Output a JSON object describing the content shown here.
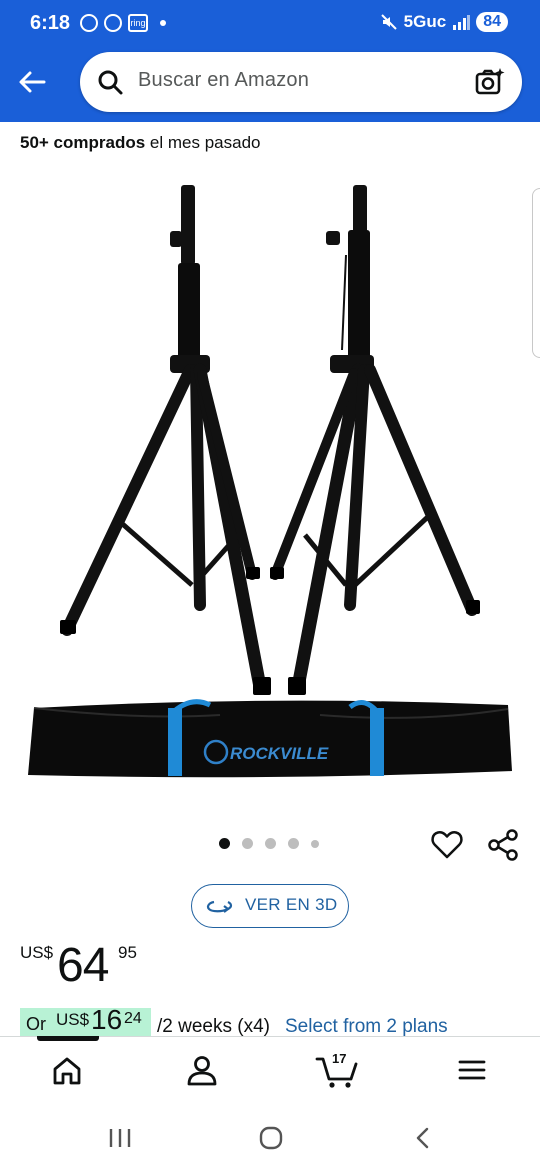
{
  "status_bar": {
    "time": "6:18",
    "app_badge": "ring",
    "network": "5Guc",
    "battery": "84"
  },
  "search": {
    "placeholder": "Buscar en Amazon"
  },
  "product": {
    "purchased_bold": "50+ comprados",
    "purchased_rest": " el mes pasado",
    "image_brand": "ROCKVILLE",
    "image_count": 5,
    "image_active_index": 0,
    "view_3d_label": "VER EN 3D"
  },
  "price": {
    "currency": "US$",
    "whole": "64",
    "fraction": "95"
  },
  "installment": {
    "prefix": "Or",
    "currency": "US$",
    "whole": "16",
    "fraction": "24",
    "period_text": "/2 weeks (x4)",
    "link": "Select from 2 plans"
  },
  "bottom_nav": {
    "items": [
      "home-icon",
      "account-icon",
      "cart-icon",
      "menu-icon"
    ],
    "cart_count": "17",
    "active": "home"
  },
  "colors": {
    "header_bg": "#1a5fd8",
    "link": "#2162a1",
    "installment_badge": "#b8f2d5"
  }
}
